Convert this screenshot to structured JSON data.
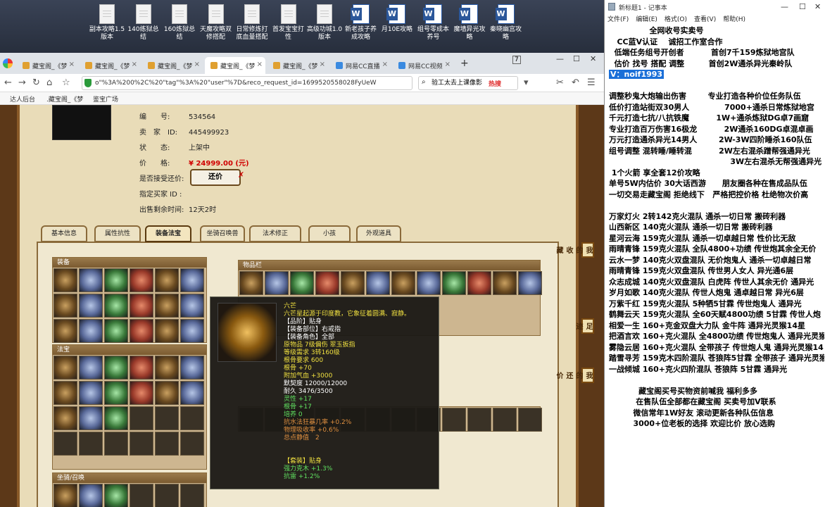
{
  "desktop": {
    "icons": [
      {
        "label": "副本攻略1.5版本",
        "type": "doc"
      },
      {
        "label": "140练狱总结",
        "type": "doc"
      },
      {
        "label": "160炼狱总结",
        "type": "doc"
      },
      {
        "label": "天魔攻略双修搭配",
        "type": "doc"
      },
      {
        "label": "日常修炼打底血量搭配",
        "type": "doc"
      },
      {
        "label": "首发宝宝打性",
        "type": "doc"
      },
      {
        "label": "高级功城1.0版本",
        "type": "doc"
      },
      {
        "label": "新老孩子养成攻略",
        "type": "word"
      },
      {
        "label": "月10E攻略",
        "type": "word"
      },
      {
        "label": "组号零成本养号",
        "type": "word"
      },
      {
        "label": "魔墙异光攻略",
        "type": "word"
      },
      {
        "label": "秦晓幽宫攻略",
        "type": "word"
      }
    ]
  },
  "browser": {
    "tabs": [
      "藏宝阁_《梦",
      "藏宝阁_《梦",
      "藏宝阁_《梦",
      "藏宝阁_《梦",
      "藏宝阁_《梦",
      "网易CC直播",
      "网易CC视频"
    ],
    "url": "o\"%3A%200%2C%20\"tag\"%3A%20\"user\"%7D&reco_request_id=1699520558028FyUeW",
    "search": "验工太去上课像影",
    "hot": "热搜",
    "bookmarks": [
      "达人后台",
      ".藏宝阁_《梦",
      "鉴宝广场"
    ]
  },
  "item": {
    "fields": [
      {
        "label": "编　　号:",
        "value": "534564"
      },
      {
        "label": "卖　家　ID:",
        "value": "445499923"
      },
      {
        "label": "状　　态:",
        "value": "上架中"
      },
      {
        "label": "价　　格:",
        "value": "¥ 24999.00 (元)"
      },
      {
        "label": "是否接受还价:",
        "value": ""
      },
      {
        "label": "指定买家 ID :",
        "value": ""
      },
      {
        "label": "出售剩余时间:",
        "value": "12天2时"
      }
    ],
    "bargain": "还价"
  },
  "gametabs": [
    "基本信息",
    "属性抗性",
    "装备法宝",
    "坐骑召唤兽",
    "法术修正",
    "小孩",
    "外观道具"
  ],
  "sections": {
    "equip": "装备",
    "bag": "物品栏",
    "fabao": "法宝",
    "pets": "坐骑/召唤"
  },
  "tooltip": {
    "name": "六芒",
    "desc": "六芒星起源于印度教，它象征着圆满、寂静。",
    "lines": [
      {
        "t": "【品阶】贴身",
        "c": "w"
      },
      {
        "t": "【装备部位】右戒指",
        "c": "w"
      },
      {
        "t": "【装备角色】全部",
        "c": "w"
      },
      {
        "t": "原物品 7级偏伤 翠玉扳指",
        "c": "y"
      },
      {
        "t": "等级需求 3转160级",
        "c": "y"
      },
      {
        "t": "根骨要求 600",
        "c": "y"
      },
      {
        "t": "根骨 +70",
        "c": "y"
      },
      {
        "t": "附加气血 +3000",
        "c": "y"
      },
      {
        "t": "默契度 12000/12000",
        "c": "w"
      },
      {
        "t": "耐久 3476/3500",
        "c": "w"
      },
      {
        "t": "灵性 +17",
        "c": "g"
      },
      {
        "t": "根骨 +17",
        "c": "g"
      },
      {
        "t": "培养 0",
        "c": "g"
      },
      {
        "t": "抗水法狂暴几率 +0.2%",
        "c": "o"
      },
      {
        "t": "物理吸收率 +0.6%",
        "c": "o"
      },
      {
        "t": "总点静值　2",
        "c": "o"
      },
      {
        "t": "",
        "c": "w"
      },
      {
        "t": "",
        "c": "w"
      },
      {
        "t": "【套装】贴身",
        "c": "y"
      },
      {
        "t": "强力克木 +1.3%",
        "c": "g"
      },
      {
        "t": "抗雷 +1.2%",
        "c": "g"
      }
    ]
  },
  "sidebtns": [
    "我的收藏",
    "足迹",
    "我的还价"
  ],
  "notepad": {
    "title": "新标题1 - 记事本",
    "menu": [
      "文件(F)",
      "编辑(E)",
      "格式(O)",
      "查看(V)",
      "帮助(H)"
    ],
    "text": "               全网收号实卖号\n   CC蓝V认证    诚招工作室合作\n  低端任务组号开创者          首创7千159炼狱地宫队\n  估价 找号 搭配 调整         首创2W通杀异光秦岭队\n",
    "highlight": "V：noif1993",
    "text2": "\n\n调整秒鬼大炮输出伤害        专业打造各种价位任务队伍\n低价打造站街双30男人             7000+通杀日常炼狱地宫\n千元打造七抗/八抗铁魔          1W+通杀炼狱DG卓7画窟\n专业打造百万伤害16极龙          2W通杀160DG卓混卓画\n万元打造通杀异光14男人        2W-3W四阶睡杀160队伍\n组号调整 混转睡/睡转混          2W左右混杀蹭帮强通异光\n                                             3W左右混杀无帮强通异光\n 1个火箭 享全套12价攻略\n单号5W内估价 30大话西游      朋友圈各种在售成品队伍\n一切交易走藏宝阁 拒绝线下   严格把控价格 杜绝物次价高\n\n万家灯火 2转142克火混队 通杀一切日常 搬砖利器\n山西新区 140克火混队 通杀一切日常 搬砖利器\n星河云海 159克火混队 通杀一切卓越日常 性价比无敌\n雨晴青锋 159克火混队 全队4800+功绩 传世炮其余全无价\n云水一梦 140克火双盘混队 无价炮鬼人 通杀一切卓越日常\n雨晴青锋 159克火双盘混队 传世男人女人 异光通6层\n众志成城 140克火双盘混队 白虎阵 传世人其余无价 通异光\n岁月如歌 140克火混队 传世人炮鬼 通卓越日常 异光6层\n万紫千红 159克火混队 5种牺5甘霖 传世炮鬼人 通异光\n鹤舞云天 159克火混队 全60天赋4800功绩 5甘霖 传世人炮\n相爱一生 160+克金双盘大力队 金牛阵 通异光灵猴14星\n把酒言欢 160+克火混队 全4800功绩 传世炮鬼人 通异光灵猴\n雾隐云居 160+克火混队 全带孩子 传世炮人鬼 通异光灵猴14\n踏雪寻芳 159克木四阶混队 苍狼阵5甘霖 全带孩子 通异光灵猴\n一战倾城 160+克火四阶混队 苍狼阵 5甘霖 通异光\n\n           藏宝阁买号买物资前喊我 福利多多\n          在售队伍全部都在藏宝阁 买卖号加V联系\n         微信常年1W好友 滚动更新各种队伍信息\n         3000+位老板的选择 欢迎比价 放心选购"
  }
}
